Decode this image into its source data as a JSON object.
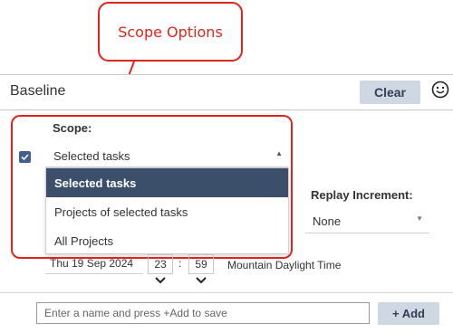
{
  "callout": {
    "text": "Scope Options"
  },
  "panel": {
    "title": "Baseline",
    "clear_label": "Clear",
    "smiley_icon": "smiley-face-icon"
  },
  "scope": {
    "label": "Scope:",
    "checked": true,
    "selected_value": "Selected tasks",
    "options": [
      "Selected tasks",
      "Projects of selected tasks",
      "All Projects"
    ],
    "highlighted_index": 0
  },
  "replay": {
    "label": "Replay Increment:",
    "value": "None"
  },
  "datetime": {
    "date": "Thu 19 Sep 2024",
    "hour": "23",
    "separator": ":",
    "minute": "59",
    "timezone": "Mountain Daylight Time"
  },
  "footer": {
    "placeholder": "Enter a name and press +Add to save",
    "add_label": "+ Add"
  },
  "colors": {
    "annotation": "#e0241c",
    "button_bg": "#cfd7e3",
    "selected_bg": "#3b4f6b",
    "checkbox": "#3f5f8f"
  }
}
